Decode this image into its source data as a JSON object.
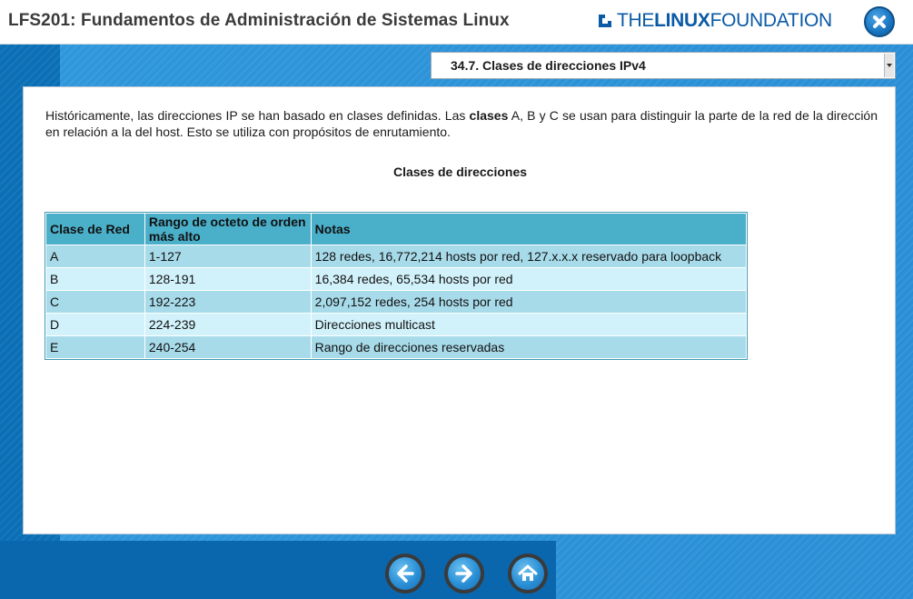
{
  "header": {
    "course_title": "LFS201: Fundamentos de Administración de Sistemas Linux",
    "logo_light_1": "THE",
    "logo_bold": "LINUX",
    "logo_light_2": "FOUNDATION",
    "close_icon": "close-icon"
  },
  "section_select": {
    "selected": "34.7. Clases de direcciones IPv4"
  },
  "content": {
    "intro_part1": "Históricamente, las direcciones IP se han basado en clases definidas. Las ",
    "intro_bold": "clases",
    "intro_part2": " A, B y C se usan para distinguir la parte de la red de la dirección en relación a la del host. Esto se utiliza con propósitos de enrutamiento.",
    "table_title": "Clases de direcciones",
    "table": {
      "headers": [
        "Clase de Red",
        "Rango de octeto de orden más alto",
        "Notas"
      ],
      "rows": [
        [
          "A",
          "1-127",
          "128 redes, 16,772,214 hosts por red, 127.x.x.x reservado para loopback"
        ],
        [
          "B",
          "128-191",
          "16,384 redes, 65,534 hosts por red"
        ],
        [
          "C",
          "192-223",
          "2,097,152 redes, 254 hosts por red"
        ],
        [
          "D",
          "224-239",
          "Direcciones multicast"
        ],
        [
          "E",
          "240-254",
          "Rango de direcciones reservadas"
        ]
      ]
    }
  },
  "nav": {
    "back_icon": "arrow-left-icon",
    "next_icon": "arrow-right-icon",
    "home_icon": "home-icon"
  },
  "colors": {
    "header_bg": "#ffffff",
    "stage_blue": "#2f97db",
    "table_header": "#4aafc9",
    "row_odd": "#a8dbea",
    "row_even": "#d2f2fb",
    "brand_blue": "#0a5aa6"
  }
}
